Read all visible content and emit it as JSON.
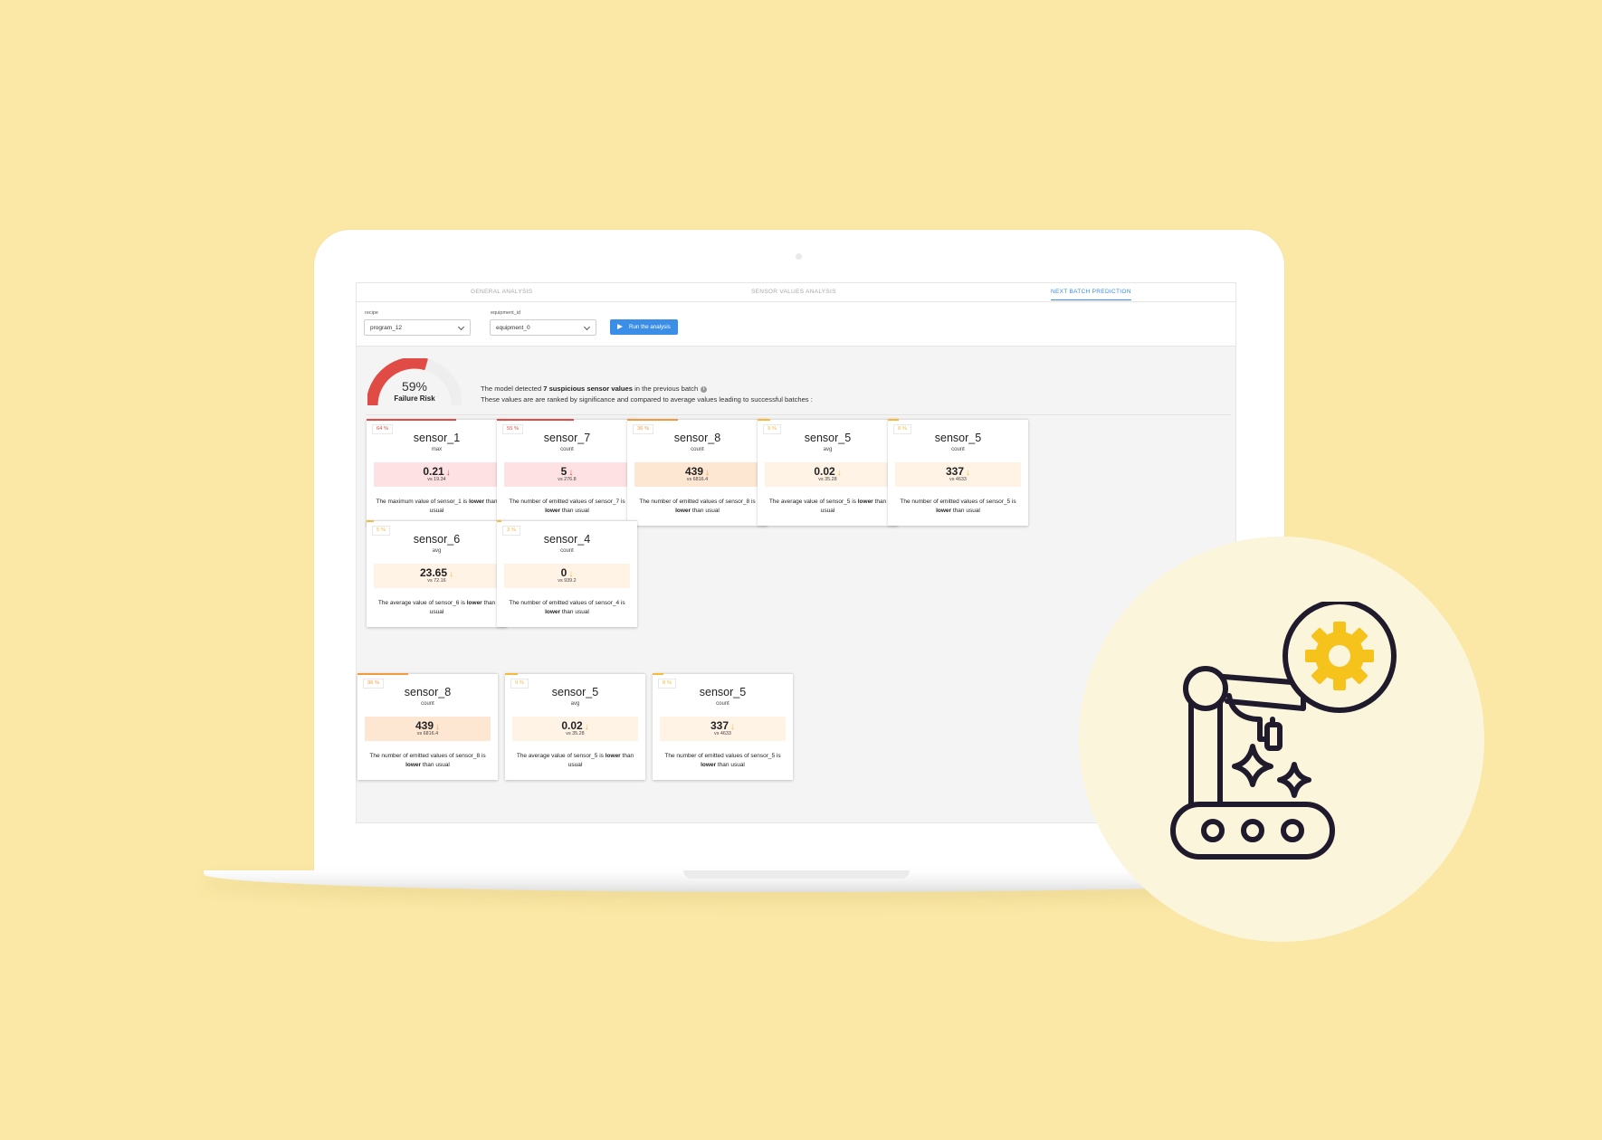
{
  "tabs": [
    {
      "label": "GENERAL ANALYSIS",
      "active": false
    },
    {
      "label": "SENSOR VALUES ANALYSIS",
      "active": false
    },
    {
      "label": "NEXT BATCH PREDICTION",
      "active": true
    }
  ],
  "controls": {
    "recipe": {
      "label": "recipe",
      "value": "program_12"
    },
    "equipment": {
      "label": "equipment_id",
      "value": "equipment_0"
    },
    "run_label": "Run the analysis"
  },
  "risk": {
    "percent_text": "59%",
    "fraction": 0.59,
    "label": "Failure Risk",
    "color": "#e04b45"
  },
  "summary": {
    "line1_pre": "The model detected ",
    "line1_bold": "7 suspicious sensor values",
    "line1_post": " in the previous batch",
    "line2": "These values are are ranked by significance and compared to average values leading to successful batches :"
  },
  "cards": [
    {
      "pct": "64 %",
      "name": "sensor_1",
      "metric": "max",
      "value": "0.21",
      "vs": "vs 19.34",
      "severity": "red",
      "bar_fraction": 0.64,
      "desc_pre": "The maximum value of sensor_1 is ",
      "desc_bold": "lower",
      "desc_post": " than usual"
    },
    {
      "pct": "55 %",
      "name": "sensor_7",
      "metric": "count",
      "value": "5",
      "vs": "vs 276.8",
      "severity": "red",
      "bar_fraction": 0.55,
      "desc_pre": "The number of emitted values of sensor_7 is ",
      "desc_bold": "lower",
      "desc_post": " than usual"
    },
    {
      "pct": "36 %",
      "name": "sensor_8",
      "metric": "count",
      "value": "439",
      "vs": "vs 6816.4",
      "severity": "orange",
      "bar_fraction": 0.36,
      "desc_pre": "The number of emitted values of sensor_8 is ",
      "desc_bold": "lower",
      "desc_post": " than usual"
    },
    {
      "pct": "9 %",
      "name": "sensor_5",
      "metric": "avg",
      "value": "0.02",
      "vs": "vs 35.28",
      "severity": "yellow",
      "bar_fraction": 0.09,
      "desc_pre": "The average value of sensor_5 is ",
      "desc_bold": "lower",
      "desc_post": " than usual"
    },
    {
      "pct": "8 %",
      "name": "sensor_5",
      "metric": "count",
      "value": "337",
      "vs": "vs 4633",
      "severity": "yellow",
      "bar_fraction": 0.08,
      "desc_pre": "The number of emitted values of sensor_5 is ",
      "desc_bold": "lower",
      "desc_post": " than usual"
    },
    {
      "pct": "5 %",
      "name": "sensor_6",
      "metric": "avg",
      "value": "23.65",
      "vs": "vs 72.16",
      "severity": "yellow",
      "bar_fraction": 0.05,
      "desc_pre": "The average value of sensor_6 is ",
      "desc_bold": "lower",
      "desc_post": " than usual"
    },
    {
      "pct": "3 %",
      "name": "sensor_4",
      "metric": "count",
      "value": "0",
      "vs": "vs 939.2",
      "severity": "yellow",
      "bar_fraction": 0.03,
      "desc_pre": "The number of emitted values of sensor_4 is ",
      "desc_bold": "lower",
      "desc_post": " than usual"
    }
  ],
  "float_cards": [
    {
      "pct": "36 %",
      "name": "sensor_8",
      "metric": "count",
      "value": "439",
      "vs": "vs 6816.4",
      "severity": "orange",
      "bar_fraction": 0.36,
      "desc_pre": "The number of emitted values of sensor_8 is ",
      "desc_bold": "lower",
      "desc_post": " than usual"
    },
    {
      "pct": "9 %",
      "name": "sensor_5",
      "metric": "avg",
      "value": "0.02",
      "vs": "vs 35.28",
      "severity": "yellow",
      "bar_fraction": 0.09,
      "desc_pre": "The average value of sensor_5 is ",
      "desc_bold": "lower",
      "desc_post": " than usual"
    },
    {
      "pct": "8 %",
      "name": "sensor_5",
      "metric": "count",
      "value": "337",
      "vs": "vs 4633",
      "severity": "yellow",
      "bar_fraction": 0.08,
      "desc_pre": "The number of emitted values of sensor_5 is ",
      "desc_bold": "lower",
      "desc_post": " than usual"
    }
  ],
  "arrow_glyph": "↓",
  "icons": {
    "dropdown": "chevron-down-icon",
    "run": "play-icon",
    "info": "info-icon",
    "illustration": "robot-arm-gear-icon"
  },
  "colors": {
    "background": "#fbe8a6",
    "accent": "#3a8ee8",
    "gear": "#f6c21c",
    "ink": "#1f1b2d"
  }
}
